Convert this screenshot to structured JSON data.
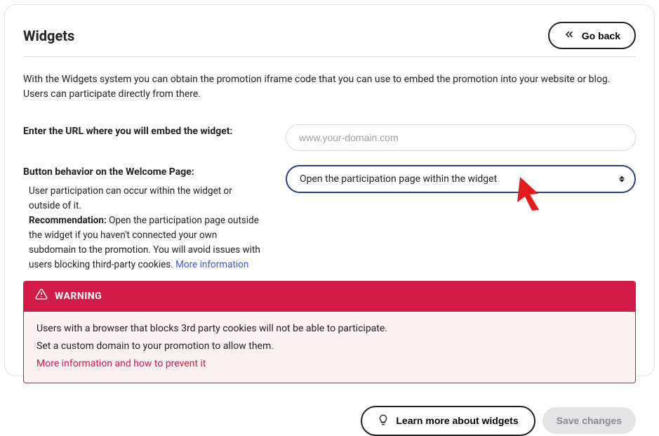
{
  "header": {
    "title": "Widgets",
    "go_back_label": "Go back"
  },
  "intro_text": "With the Widgets system you can obtain the promotion iframe code that you can use to embed the promotion into your website or blog. Users can participate directly from there.",
  "form": {
    "url_label": "Enter the URL where you will embed the widget:",
    "url_placeholder": "www.your-domain.com",
    "url_value": "",
    "behavior_label": "Button behavior on the Welcome Page:",
    "behavior_selected": "Open the participation page within the widget",
    "help_line1": "User participation can occur within the widget or outside of it.",
    "help_reco_label": "Recommendation:",
    "help_reco_text": " Open the participation page outside the widget if you haven't connected your own subdomain to the promotion. You will avoid issues with users blocking third-party cookies. ",
    "help_more_info": "More information"
  },
  "warning": {
    "title": "WARNING",
    "line1": "Users with a browser that blocks 3rd party cookies will not be able to participate.",
    "line2": "Set a custom domain to your promotion to allow them.",
    "link": "More information and how to prevent it"
  },
  "footer": {
    "learn_label": "Learn more about widgets",
    "save_label": "Save changes"
  }
}
